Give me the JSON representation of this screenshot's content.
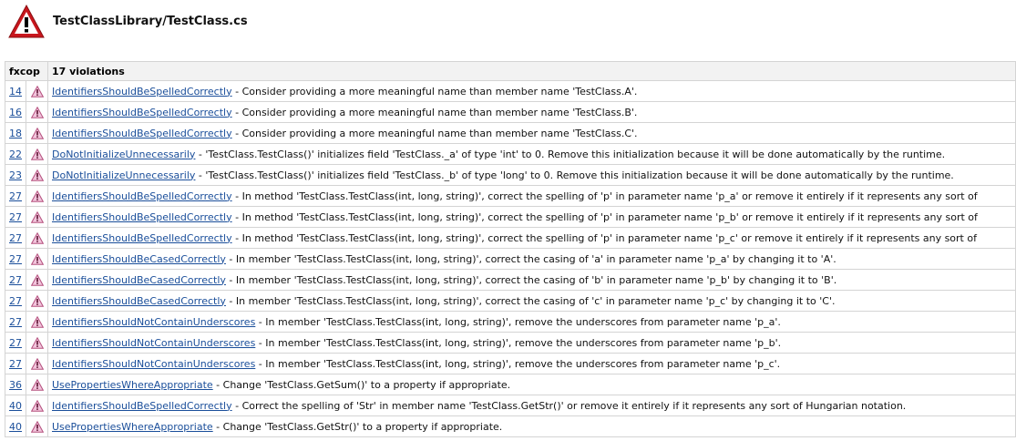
{
  "file": {
    "title": "TestClassLibrary/TestClass.cs",
    "icon": "warning-icon"
  },
  "table": {
    "headers": [
      "fxcop",
      "17 violations"
    ],
    "rows": [
      {
        "line": "14",
        "rule": "IdentifiersShouldBeSpelledCorrectly",
        "message": " - Consider providing a more meaningful name than member name 'TestClass.A'."
      },
      {
        "line": "16",
        "rule": "IdentifiersShouldBeSpelledCorrectly",
        "message": " - Consider providing a more meaningful name than member name 'TestClass.B'."
      },
      {
        "line": "18",
        "rule": "IdentifiersShouldBeSpelledCorrectly",
        "message": " - Consider providing a more meaningful name than member name 'TestClass.C'."
      },
      {
        "line": "22",
        "rule": "DoNotInitializeUnnecessarily",
        "message": " - 'TestClass.TestClass()' initializes field 'TestClass._a' of type 'int' to 0. Remove this initialization because it will be done automatically by the runtime."
      },
      {
        "line": "23",
        "rule": "DoNotInitializeUnnecessarily",
        "message": " - 'TestClass.TestClass()' initializes field 'TestClass._b' of type 'long' to 0. Remove this initialization because it will be done automatically by the runtime."
      },
      {
        "line": "27",
        "rule": "IdentifiersShouldBeSpelledCorrectly",
        "message": " - In method 'TestClass.TestClass(int, long, string)', correct the spelling of 'p' in parameter name 'p_a' or remove it entirely if it represents any sort of"
      },
      {
        "line": "27",
        "rule": "IdentifiersShouldBeSpelledCorrectly",
        "message": " - In method 'TestClass.TestClass(int, long, string)', correct the spelling of 'p' in parameter name 'p_b' or remove it entirely if it represents any sort of"
      },
      {
        "line": "27",
        "rule": "IdentifiersShouldBeSpelledCorrectly",
        "message": " - In method 'TestClass.TestClass(int, long, string)', correct the spelling of 'p' in parameter name 'p_c' or remove it entirely if it represents any sort of"
      },
      {
        "line": "27",
        "rule": "IdentifiersShouldBeCasedCorrectly",
        "message": " - In member 'TestClass.TestClass(int, long, string)', correct the casing of 'a' in parameter name 'p_a' by changing it to 'A'."
      },
      {
        "line": "27",
        "rule": "IdentifiersShouldBeCasedCorrectly",
        "message": " - In member 'TestClass.TestClass(int, long, string)', correct the casing of 'b' in parameter name 'p_b' by changing it to 'B'."
      },
      {
        "line": "27",
        "rule": "IdentifiersShouldBeCasedCorrectly",
        "message": " - In member 'TestClass.TestClass(int, long, string)', correct the casing of 'c' in parameter name 'p_c' by changing it to 'C'."
      },
      {
        "line": "27",
        "rule": "IdentifiersShouldNotContainUnderscores",
        "message": " - In member 'TestClass.TestClass(int, long, string)', remove the underscores from parameter name 'p_a'."
      },
      {
        "line": "27",
        "rule": "IdentifiersShouldNotContainUnderscores",
        "message": " - In member 'TestClass.TestClass(int, long, string)', remove the underscores from parameter name 'p_b'."
      },
      {
        "line": "27",
        "rule": "IdentifiersShouldNotContainUnderscores",
        "message": " - In member 'TestClass.TestClass(int, long, string)', remove the underscores from parameter name 'p_c'."
      },
      {
        "line": "36",
        "rule": "UsePropertiesWhereAppropriate",
        "message": " - Change 'TestClass.GetSum()' to a property if appropriate."
      },
      {
        "line": "40",
        "rule": "IdentifiersShouldBeSpelledCorrectly",
        "message": " - Correct the spelling of 'Str' in member name 'TestClass.GetStr()' or remove it entirely if it represents any sort of Hungarian notation."
      },
      {
        "line": "40",
        "rule": "UsePropertiesWhereAppropriate",
        "message": " - Change 'TestClass.GetStr()' to a property if appropriate."
      }
    ]
  },
  "colors": {
    "link": "#1a4e9a",
    "warning_red": "#c8161d",
    "row_icon_pink": "#e8a0c8"
  }
}
